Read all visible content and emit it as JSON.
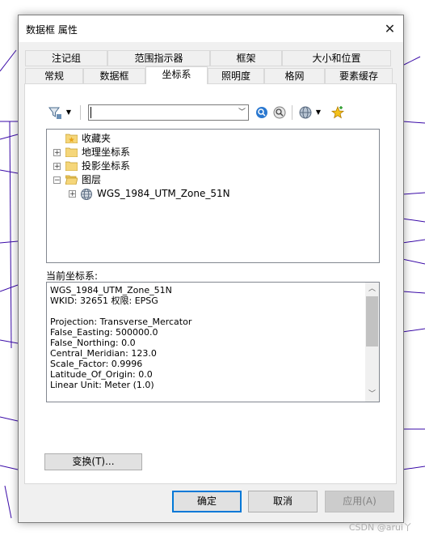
{
  "window": {
    "title": "数据框 属性",
    "close_glyph": "✕"
  },
  "tabs": {
    "back_row": [
      "注记组",
      "范围指示器",
      "框架",
      "大小和位置"
    ],
    "front_row": [
      "常规",
      "数据框",
      "坐标系",
      "照明度",
      "格网",
      "要素缓存"
    ],
    "active": "坐标系"
  },
  "toolbar": {
    "search_value": "",
    "filter_icon": "filter-icon",
    "icons": [
      "search-icon",
      "clear-search-icon",
      "globe-icon",
      "add-favorite-icon"
    ]
  },
  "tree": {
    "items": [
      {
        "label": "收藏夹",
        "icon": "favorites-folder-icon",
        "expander": ""
      },
      {
        "label": "地理坐标系",
        "icon": "folder-icon",
        "expander": "+"
      },
      {
        "label": "投影坐标系",
        "icon": "folder-icon",
        "expander": "+"
      },
      {
        "label": "图层",
        "icon": "open-folder-icon",
        "expander": "−"
      }
    ],
    "child": {
      "label": "WGS_1984_UTM_Zone_51N",
      "icon": "globe-icon",
      "expander": "+"
    }
  },
  "current_cs": {
    "label": "当前坐标系:",
    "lines": [
      "WGS_1984_UTM_Zone_51N",
      "WKID: 32651 权限: EPSG",
      "",
      "Projection: Transverse_Mercator",
      "False_Easting: 500000.0",
      "False_Northing: 0.0",
      "Central_Meridian: 123.0",
      "Scale_Factor: 0.9996",
      "Latitude_Of_Origin: 0.0",
      "Linear Unit: Meter (1.0)"
    ]
  },
  "buttons": {
    "transform": "变换(T)...",
    "ok": "确定",
    "cancel": "取消",
    "apply": "应用(A)"
  },
  "watermark": "CSDN @arui丫",
  "colors": {
    "accent": "#0078d7",
    "map_lines": "#3a0aa8"
  }
}
